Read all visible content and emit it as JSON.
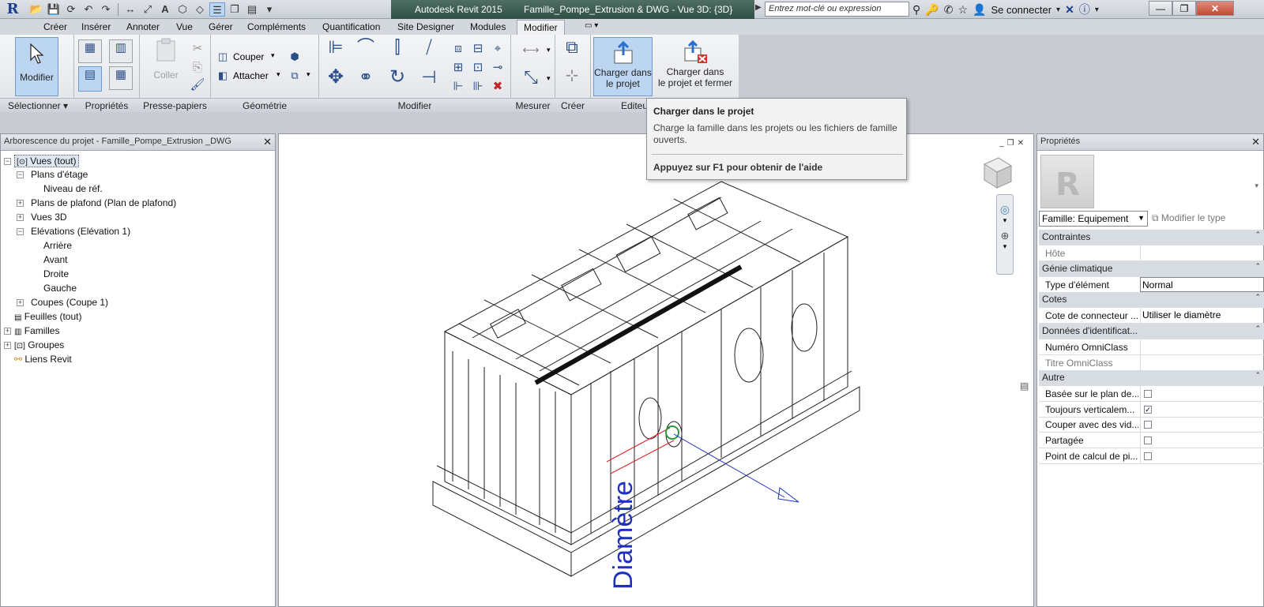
{
  "titlebar": {
    "app_title": "Autodesk Revit 2015",
    "doc_title": "Famille_Pompe_Extrusion & DWG - Vue 3D: {3D}",
    "search_placeholder": "Entrez mot-clé ou expression",
    "connect_label": "Se connecter"
  },
  "tabs": [
    "Créer",
    "Insérer",
    "Annoter",
    "Vue",
    "Gérer",
    "Compléments",
    "Quantification",
    "Site Designer",
    "Modules",
    "Modifier"
  ],
  "active_tab": "Modifier",
  "ribbon": {
    "modifier_label": "Modifier",
    "coller_label": "Coller",
    "couper_label": "Couper",
    "attacher_label": "Attacher",
    "charger_projet": [
      "Charger dans",
      "le projet"
    ],
    "charger_fermer": [
      "Charger dans",
      "le projet et fermer"
    ],
    "panels": {
      "selectionner": "Sélectionner ▾",
      "proprietes": "Propriétés",
      "presse_papiers": "Presse-papiers",
      "geometrie": "Géométrie",
      "modifier": "Modifier",
      "mesurer": "Mesurer",
      "creer": "Créer",
      "editeur": "Editeu"
    }
  },
  "tooltip": {
    "title": "Charger dans le projet",
    "description": "Charge la famille dans les projets ou les fichiers de famille ouverts.",
    "help": "Appuyez sur F1 pour obtenir de l'aide"
  },
  "browser": {
    "title": "Arborescence du projet - Famille_Pompe_Extrusion _DWG",
    "items": [
      "Vues (tout)",
      "Plans d'étage",
      "Niveau de réf.",
      "Plans de plafond (Plan de plafond)",
      "Vues 3D",
      "Elévations (Elévation 1)",
      "Arrière",
      "Avant",
      "Droite",
      "Gauche",
      "Coupes (Coupe 1)",
      "Feuilles (tout)",
      "Familles",
      "Groupes",
      "Liens Revit"
    ]
  },
  "canvas": {
    "dimension_label": "Diamètre"
  },
  "properties": {
    "title": "Propriétés",
    "type_selector": "Famille: Equipement",
    "edit_type": "Modifier le type",
    "groups": {
      "contraintes": "Contraintes",
      "genie": "Génie climatique",
      "cotes": "Cotes",
      "donnees": "Données d'identificat...",
      "autre": "Autre"
    },
    "rows": {
      "hote": "Hôte",
      "type_element": "Type d'élément",
      "type_element_val": "Normal",
      "cote_connecteur": "Cote de connecteur ...",
      "cote_connecteur_val": "Utiliser le diamètre",
      "numero_omniclass": "Numéro OmniClass",
      "titre_omniclass": "Titre OmniClass",
      "basee": "Basée sur le plan de...",
      "toujours": "Toujours verticalem...",
      "couper_vides": "Couper avec des vid...",
      "partagee": "Partagée",
      "point_calcul": "Point de calcul de pi..."
    },
    "checkboxes": {
      "basee": false,
      "toujours": true,
      "couper_vides": false,
      "partagee": false,
      "point_calcul": false
    }
  },
  "colors": {
    "titlebar_accent": "#2f4f45",
    "dimension_blue": "#1f2fbf",
    "selection_blue": "#bcd6f2"
  }
}
